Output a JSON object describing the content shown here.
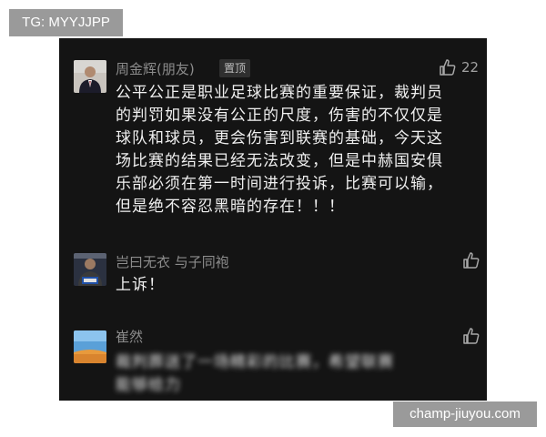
{
  "overlay": {
    "tg_badge": "TG: MYYJJPP",
    "watermark": "champ-jiuyou.com"
  },
  "comments": [
    {
      "username": "周金辉(朋友)",
      "badge": "置顶",
      "like_count": "22",
      "text": "公平公正是职业足球比赛的重要保证，裁判员\n的判罚如果没有公正的尺度，伤害的不仅仅是\n球队和球员，更会伤害到联赛的基础，今天这\n场比赛的结果已经无法改变，但是中赫国安俱\n乐部必须在第一时间进行投诉，比赛可以输，\n但是绝不容忍黑暗的存在！！！"
    },
    {
      "username": "岂曰无衣 与子同袍",
      "text": "上诉！"
    },
    {
      "username": "崔然",
      "text": "裁判葬送了一场精彩的比赛，希望联赛\n能够给力"
    }
  ],
  "icons": {
    "like": "thumbs-up-icon"
  }
}
